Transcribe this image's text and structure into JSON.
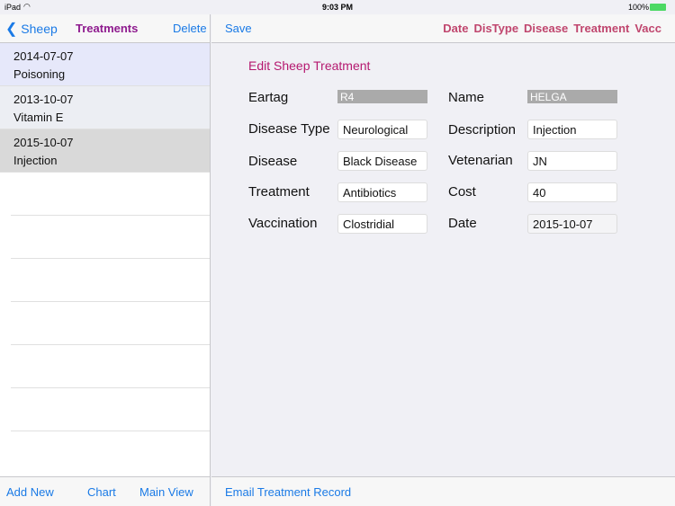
{
  "status": {
    "device": "iPad",
    "time": "9:03 PM",
    "battery": "100%",
    "battery_color": "#4cd964"
  },
  "left": {
    "back": "Sheep",
    "title": "Treatments",
    "delete": "Delete",
    "items": [
      {
        "date": "2014-07-07",
        "name": "Poisoning"
      },
      {
        "date": "2013-10-07",
        "name": "Vitamin E"
      },
      {
        "date": "2015-10-07",
        "name": "Injection"
      }
    ],
    "footer": {
      "add": "Add New",
      "chart": "Chart",
      "main": "Main View"
    }
  },
  "right": {
    "save": "Save",
    "sort": [
      "Date",
      "DisType",
      "Disease",
      "Treatment",
      "Vacc"
    ],
    "heading": "Edit Sheep Treatment",
    "fields": {
      "eartag": {
        "label": "Eartag",
        "value": "R4"
      },
      "name": {
        "label": "Name",
        "value": "HELGA"
      },
      "distype": {
        "label": "Disease Type",
        "value": "Neurological"
      },
      "desc": {
        "label": "Description",
        "value": "Injection"
      },
      "disease": {
        "label": "Disease",
        "value": "Black Disease"
      },
      "vet": {
        "label": "Vetenarian",
        "value": "JN"
      },
      "treat": {
        "label": "Treatment",
        "value": "Antibiotics"
      },
      "cost": {
        "label": "Cost",
        "value": "40"
      },
      "vacc": {
        "label": "Vaccination",
        "value": "Clostridial"
      },
      "date": {
        "label": "Date",
        "value": "2015-10-07"
      }
    },
    "footer": {
      "email": "Email Treatment Record"
    }
  },
  "colors": {
    "accent": "#1a7ae6",
    "title": "#8e1a8e",
    "heading": "#b5186f",
    "sort": "#c0466e"
  }
}
